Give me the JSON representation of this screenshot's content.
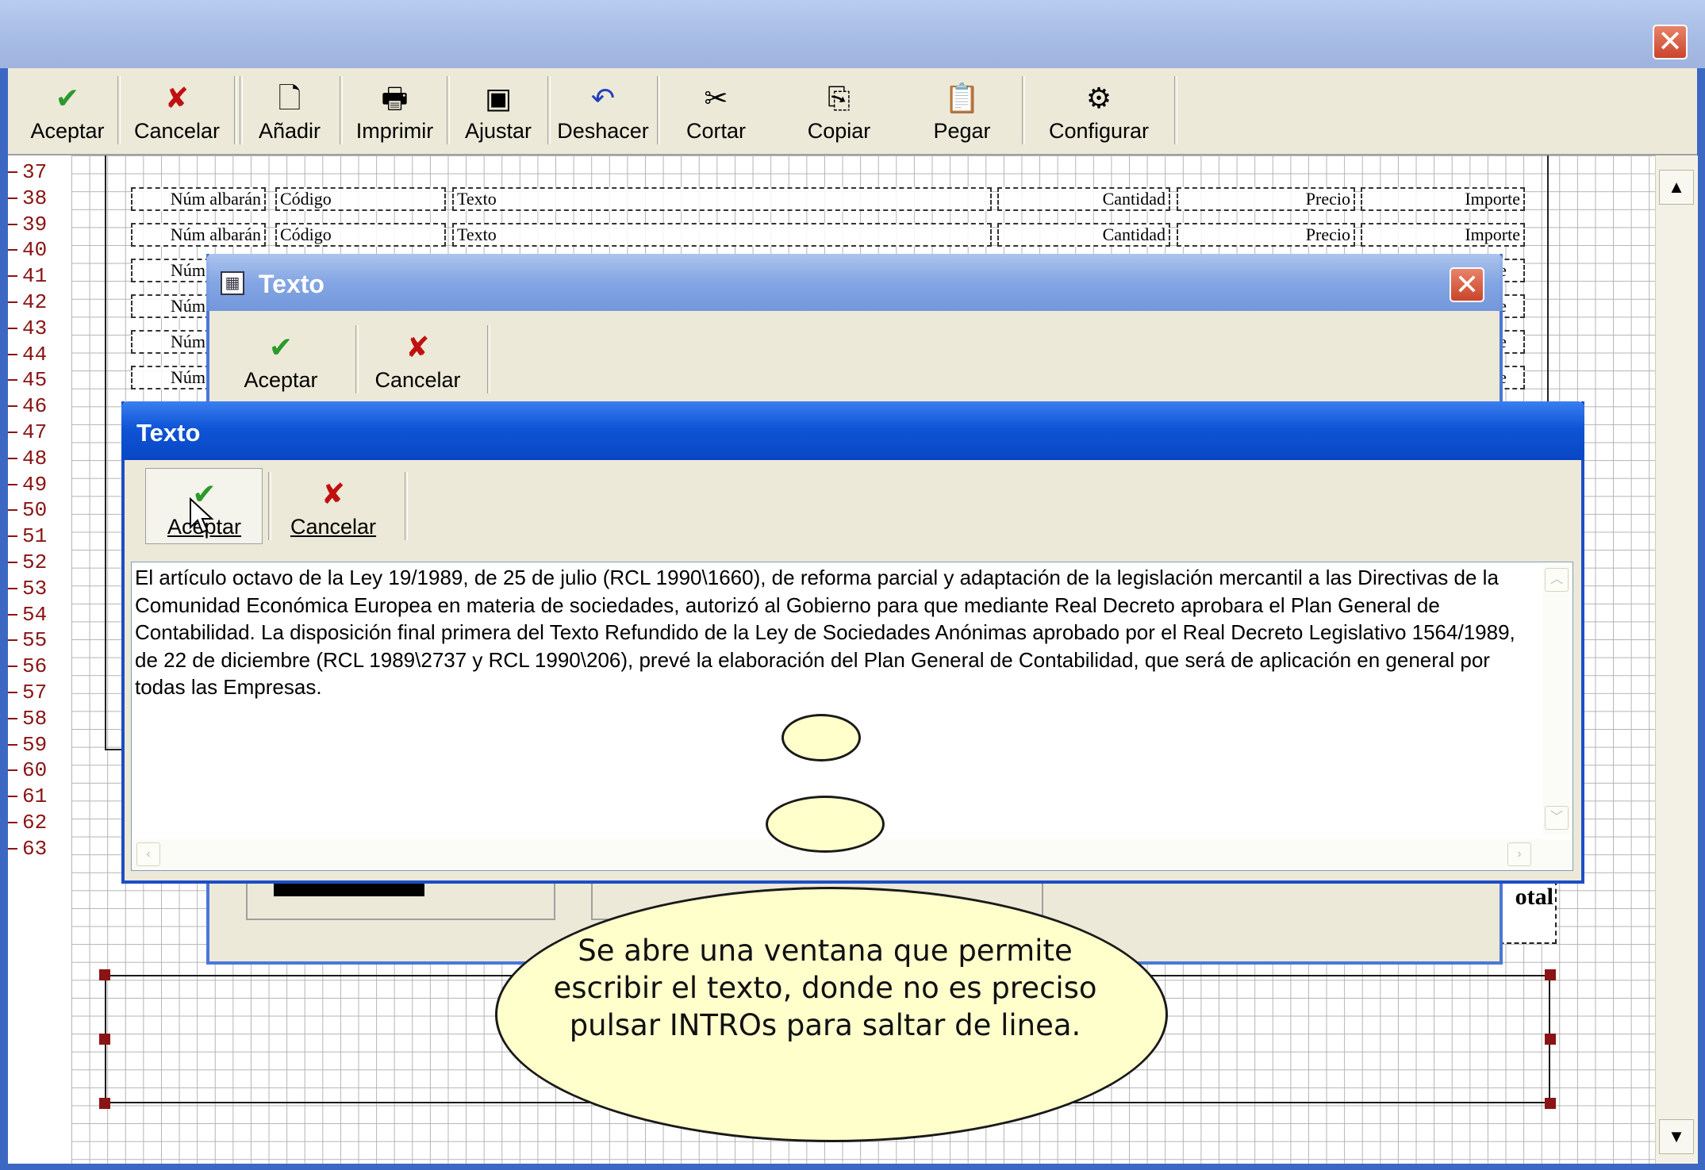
{
  "main": {
    "close_glyph": "✕",
    "toolbar": [
      {
        "label": "Aceptar",
        "icon": "check-icon",
        "glyph": "✔"
      },
      {
        "label": "Cancelar",
        "icon": "cross-icon",
        "glyph": "✘"
      },
      {
        "label": "Añadir",
        "icon": "new-document-icon",
        "glyph": "🗋"
      },
      {
        "label": "Imprimir",
        "icon": "printer-icon",
        "glyph": "🖶"
      },
      {
        "label": "Ajustar",
        "icon": "monitor-icon",
        "glyph": "▣"
      },
      {
        "label": "Deshacer",
        "icon": "undo-icon",
        "glyph": "↶"
      },
      {
        "label": "Cortar",
        "icon": "scissors-icon",
        "glyph": "✂"
      },
      {
        "label": "Copiar",
        "icon": "copy-icon",
        "glyph": "⎘"
      },
      {
        "label": "Pegar",
        "icon": "paste-icon",
        "glyph": "📋"
      },
      {
        "label": "Configurar",
        "icon": "gear-icon",
        "glyph": "⚙"
      }
    ]
  },
  "ruler": [
    "37",
    "38",
    "39",
    "40",
    "41",
    "42",
    "43",
    "44",
    "45",
    "46",
    "47",
    "48",
    "49",
    "50",
    "51",
    "52",
    "53",
    "54",
    "55",
    "56",
    "57",
    "58",
    "59",
    "60",
    "61",
    "62",
    "63"
  ],
  "report": {
    "headers": {
      "albaran": "Núm albarán",
      "codigo": "Código",
      "texto": "Texto",
      "cantidad": "Cantidad",
      "precio": "Precio",
      "importe": "Importe"
    },
    "truncated_albaran": "Núm",
    "truncated_importe": "te",
    "total_label": "otal"
  },
  "dialog_back": {
    "title": "Texto",
    "accept": "Aceptar",
    "cancel": "Cancelar",
    "close_glyph": "✕"
  },
  "dialog_front": {
    "title": "Texto",
    "accept": "Aceptar",
    "cancel": "Cancelar",
    "text": "El artículo octavo de la Ley 19/1989, de 25 de julio (RCL 1990\\1660), de reforma parcial y adaptación de la legislación mercantil a las Directivas de la Comunidad Económica Europea en materia de sociedades, autorizó al Gobierno para que mediante Real Decreto aprobara el Plan General de Contabilidad. La disposición final primera del Texto Refundido de la Ley de Sociedades Anónimas aprobado por el Real Decreto Legislativo 1564/1989, de 22 de diciembre (RCL 1989\\2737 y RCL 1990\\206), prevé la elaboración del Plan General de Contabilidad, que será de aplicación en general por todas las Empresas."
  },
  "callout": {
    "text": "Se abre una ventana que permite escribir el texto, donde no es preciso pulsar INTROs para saltar de linea."
  },
  "colors": {
    "ruler": "#8a1414",
    "callout_fill": "#ffffcc",
    "front_title": "#0f55d6",
    "back_title": "#7ea2e4"
  }
}
